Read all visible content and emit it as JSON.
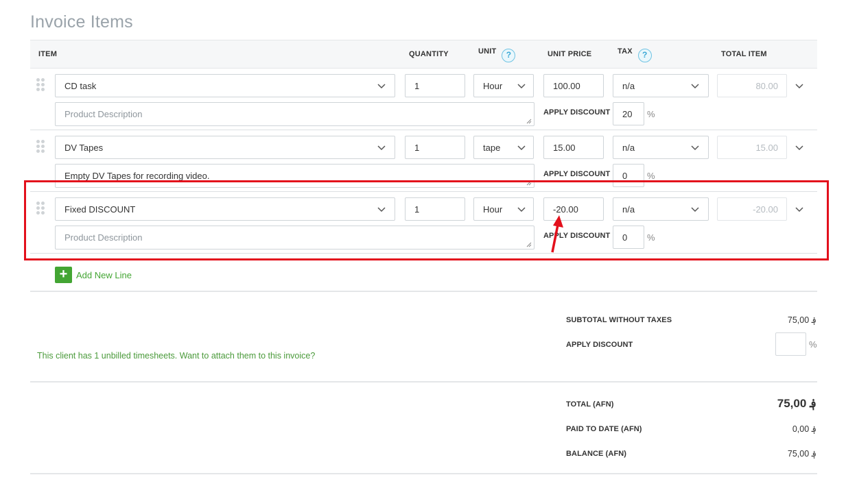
{
  "title": "Invoice Items",
  "headers": {
    "item": "ITEM",
    "quantity": "QUANTITY",
    "unit": "UNIT",
    "unit_price": "UNIT PRICE",
    "tax": "TAX",
    "total_item": "TOTAL ITEM",
    "help_glyph": "?"
  },
  "rows": [
    {
      "item": "CD task",
      "description_value": "",
      "description_placeholder": "Product Description",
      "quantity": "1",
      "unit": "Hour",
      "unit_price": "100.00",
      "tax": "n/a",
      "total": "80.00",
      "apply_discount_label": "APPLY DISCOUNT",
      "discount": "20",
      "pct": "%"
    },
    {
      "item": "DV Tapes",
      "description_value": "Empty DV Tapes for recording video.",
      "description_placeholder": "Product Description",
      "quantity": "1",
      "unit": "tape",
      "unit_price": "15.00",
      "tax": "n/a",
      "total": "15.00",
      "apply_discount_label": "APPLY DISCOUNT",
      "discount": "0",
      "pct": "%"
    },
    {
      "item": "Fixed DISCOUNT",
      "description_value": "",
      "description_placeholder": "Product Description",
      "quantity": "1",
      "unit": "Hour",
      "unit_price": "-20.00",
      "tax": "n/a",
      "total": "-20.00",
      "apply_discount_label": "APPLY DISCOUNT",
      "discount": "0",
      "pct": "%"
    }
  ],
  "add_line": {
    "icon": "+",
    "label": "Add New Line"
  },
  "timesheet_notice": "This client has 1 unbilled timesheets. Want to attach them to this invoice?",
  "summary": {
    "subtotal_label": "SUBTOTAL WITHOUT TAXES",
    "subtotal_value": "75,00 ؋",
    "apply_discount_label": "APPLY DISCOUNT",
    "discount_value": "",
    "discount_pct": "%",
    "total_label": "TOTAL (AFN)",
    "total_value": "75,00 ؋",
    "paid_label": "PAID TO DATE (AFN)",
    "paid_value": "0,00 ؋",
    "balance_label": "BALANCE (AFN)",
    "balance_value": "75,00 ؋"
  },
  "colors": {
    "highlight": "#e3101c",
    "annotation_arrow": "#e3101c",
    "accent_green": "#43a533",
    "help_blue": "#3ba8d6"
  }
}
